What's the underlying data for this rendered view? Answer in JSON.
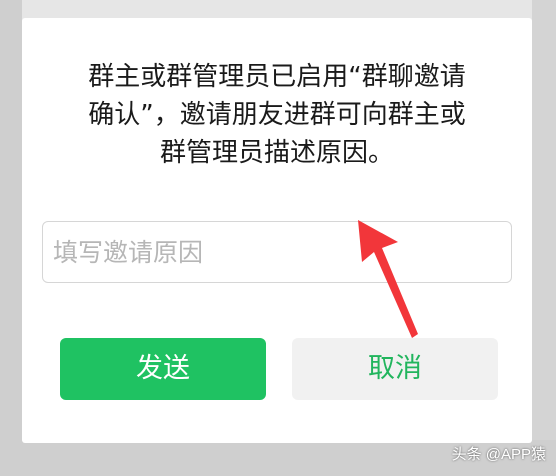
{
  "dialog": {
    "message_lines": [
      "群主或群管理员已启用“群聊邀请",
      "确认”，邀请朋友进群可向群主或",
      "群管理员描述原因。"
    ],
    "reason_placeholder": "填写邀请原因",
    "send_label": "发送",
    "cancel_label": "取消"
  },
  "watermark": "头条 @APP猿",
  "colors": {
    "send_button": "#1fc262",
    "cancel_text": "#21b55d",
    "arrow": "#f2363a"
  }
}
